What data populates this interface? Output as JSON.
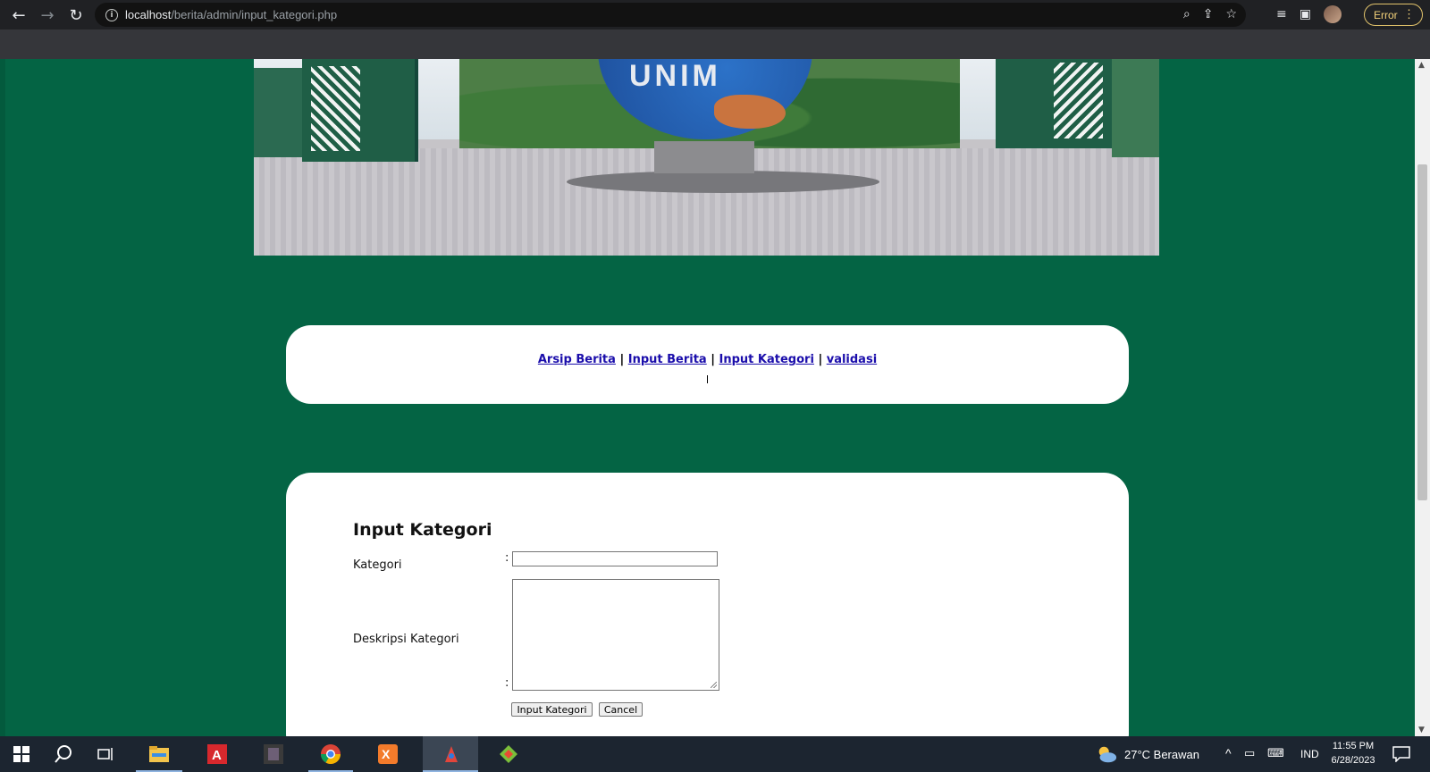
{
  "browser": {
    "url_host": "localhost",
    "url_path": "/berita/admin/input_kategori.php",
    "profile_status": "Error"
  },
  "nav": {
    "links": [
      "Arsip Berita",
      "Input Berita",
      "Input Kategori",
      "validasi"
    ],
    "separator": "|"
  },
  "form": {
    "title": "Input Kategori",
    "kategori_label": "Kategori",
    "deskripsi_label": "Deskripsi Kategori",
    "colon": ":",
    "kategori_value": "",
    "deskripsi_value": "",
    "submit_label": "Input Kategori",
    "cancel_label": "Cancel"
  },
  "banner": {
    "globe_text": "UNIM"
  },
  "taskbar": {
    "weather": "27°C  Berawan",
    "language": "IND",
    "time": "11:55 PM",
    "date": "6/28/2023"
  },
  "colors": {
    "page_background": "#046444",
    "panel_background": "#ffffff",
    "link": "#1a0dab"
  }
}
